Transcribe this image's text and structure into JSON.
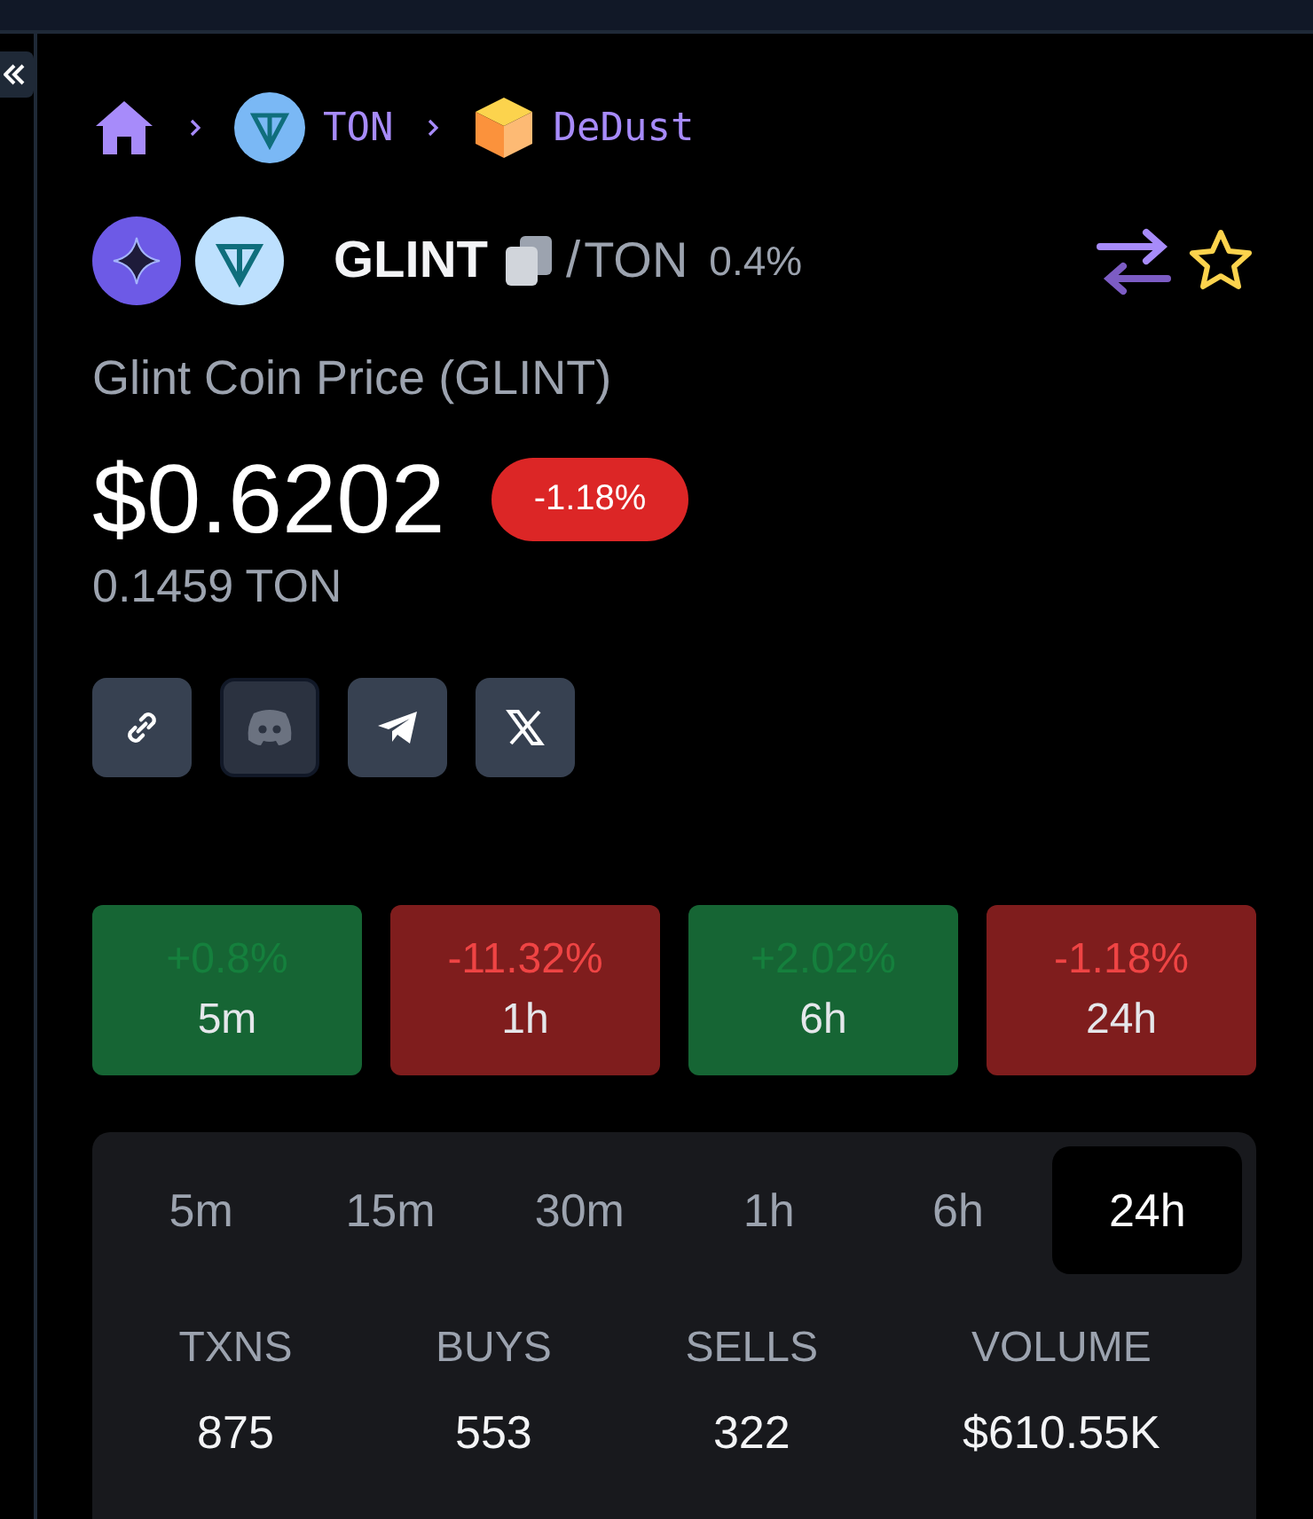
{
  "breadcrumb": [
    {
      "kind": "home"
    },
    {
      "kind": "chain",
      "label": "TON"
    },
    {
      "kind": "dex",
      "label": "DeDust"
    }
  ],
  "pair": {
    "base": "GLINT",
    "separator": "/",
    "quote": "TON",
    "fee": "0.4%"
  },
  "title": "Glint Coin Price (GLINT)",
  "price": {
    "usd": "$0.6202",
    "change": "-1.18%",
    "kind": "down",
    "native": "0.1459 TON"
  },
  "socials": [
    {
      "kind": "link",
      "disabled": false
    },
    {
      "kind": "discord",
      "disabled": true
    },
    {
      "kind": "telegram",
      "disabled": false
    },
    {
      "kind": "x",
      "disabled": false
    }
  ],
  "changes": [
    {
      "value": "+0.8%",
      "period": "5m",
      "kind": "up"
    },
    {
      "value": "-11.32%",
      "period": "1h",
      "kind": "down"
    },
    {
      "value": "+2.02%",
      "period": "6h",
      "kind": "up"
    },
    {
      "value": "-1.18%",
      "period": "24h",
      "kind": "down"
    }
  ],
  "stats": {
    "tabs": [
      {
        "label": "5m",
        "selected": false
      },
      {
        "label": "15m",
        "selected": false
      },
      {
        "label": "30m",
        "selected": false
      },
      {
        "label": "1h",
        "selected": false
      },
      {
        "label": "6h",
        "selected": false
      },
      {
        "label": "24h",
        "selected": true
      }
    ],
    "columns": [
      {
        "label": "TXNS",
        "value": "875"
      },
      {
        "label": "BUYS",
        "value": "553"
      },
      {
        "label": "SELLS",
        "value": "322"
      },
      {
        "label": "VOLUME",
        "value": "$610.55K"
      }
    ]
  }
}
